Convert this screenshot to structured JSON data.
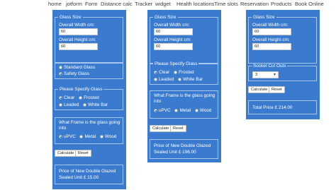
{
  "nav": {
    "items": [
      "home",
      "jotform",
      "Form",
      "Distance calc",
      "Tracker",
      "widget",
      "Health locations",
      "Time slots",
      "Reservation",
      "Products",
      "Book Online"
    ]
  },
  "form1": {
    "glass_size_legend": "Glass Size",
    "width_label": "Overall Width cm:",
    "width_value": "60",
    "height_label": "Overall Height cm:",
    "height_value": "60",
    "glass_type_options": [
      "Standard Glass",
      "Safety Glass"
    ],
    "specify_legend": "Please Specify Glass",
    "specify_options": [
      "Clear",
      "Frosted",
      "Leaded",
      "White Bar"
    ],
    "frame_question": "What Frame is the glass going into",
    "frame_options": [
      "uPVC",
      "Metal",
      "Wood"
    ],
    "calculate_label": "Calculate",
    "reset_label": "Reset",
    "result_line1": "Price of New Double Glazed",
    "result_line2": "Sealed Unit £ 15.00"
  },
  "form2": {
    "glass_size_legend": "Glass Size",
    "width_label": "Overall Width cm:",
    "width_value": "60",
    "height_label": "Overall Height cm:",
    "height_value": "60",
    "specify_legend": "Please Specify Glass",
    "specify_options": [
      "Clear",
      "Frosted",
      "Leaded",
      "White Bar"
    ],
    "frame_question": "What Frame is the glass going into",
    "frame_options": [
      "uPVC",
      "Metal",
      "Wood"
    ],
    "calculate_label": "Calculate",
    "reset_label": "Reset",
    "result_line1": "Price of New Double Glazed",
    "result_line2": "Sealed Unit £ 196.00"
  },
  "form3": {
    "glass_size_legend": "Glass Size",
    "width_label": "Overall Width cm:",
    "width_value": "60",
    "height_label": "Overall Height cm:",
    "height_value": "60",
    "socket_label": "Socket Cut Outs",
    "socket_value": "3",
    "calculate_label": "Calculate",
    "reset_label": "Reset",
    "total_price": "Total Price £ 214.00"
  }
}
